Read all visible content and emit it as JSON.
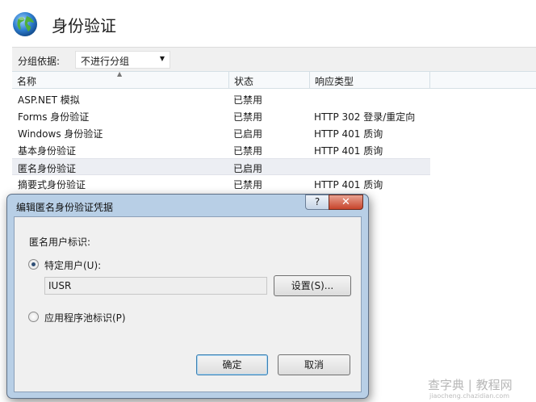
{
  "page": {
    "title": "身份验证"
  },
  "group_bar": {
    "label": "分组依据:",
    "selected": "不进行分组"
  },
  "grid": {
    "columns": [
      "名称",
      "状态",
      "响应类型"
    ],
    "rows": [
      {
        "name": "ASP.NET 模拟",
        "status": "已禁用",
        "response": ""
      },
      {
        "name": "Forms 身份验证",
        "status": "已禁用",
        "response": "HTTP 302 登录/重定向"
      },
      {
        "name": "Windows 身份验证",
        "status": "已启用",
        "response": "HTTP 401 质询"
      },
      {
        "name": "基本身份验证",
        "status": "已禁用",
        "response": "HTTP 401 质询"
      },
      {
        "name": "匿名身份验证",
        "status": "已启用",
        "response": "",
        "selected": true
      },
      {
        "name": "摘要式身份验证",
        "status": "已禁用",
        "response": "HTTP 401 质询"
      }
    ]
  },
  "dialog": {
    "title": "编辑匿名身份验证凭据",
    "help_label": "?",
    "close_label": "✕",
    "section_label": "匿名用户标识:",
    "specific_user_label": "特定用户(U):",
    "specific_user_value": "IUSR",
    "set_button": "设置(S)...",
    "app_pool_label": "应用程序池标识(P)",
    "ok_button": "确定",
    "cancel_button": "取消"
  },
  "watermark": {
    "text": "查字典 | 教程网",
    "sub": "jiaocheng.chazidian.com"
  },
  "colors": {
    "dialog_frame": "#b8cfe6",
    "close_button": "#c7442b",
    "selected_row": "#eceef3"
  }
}
